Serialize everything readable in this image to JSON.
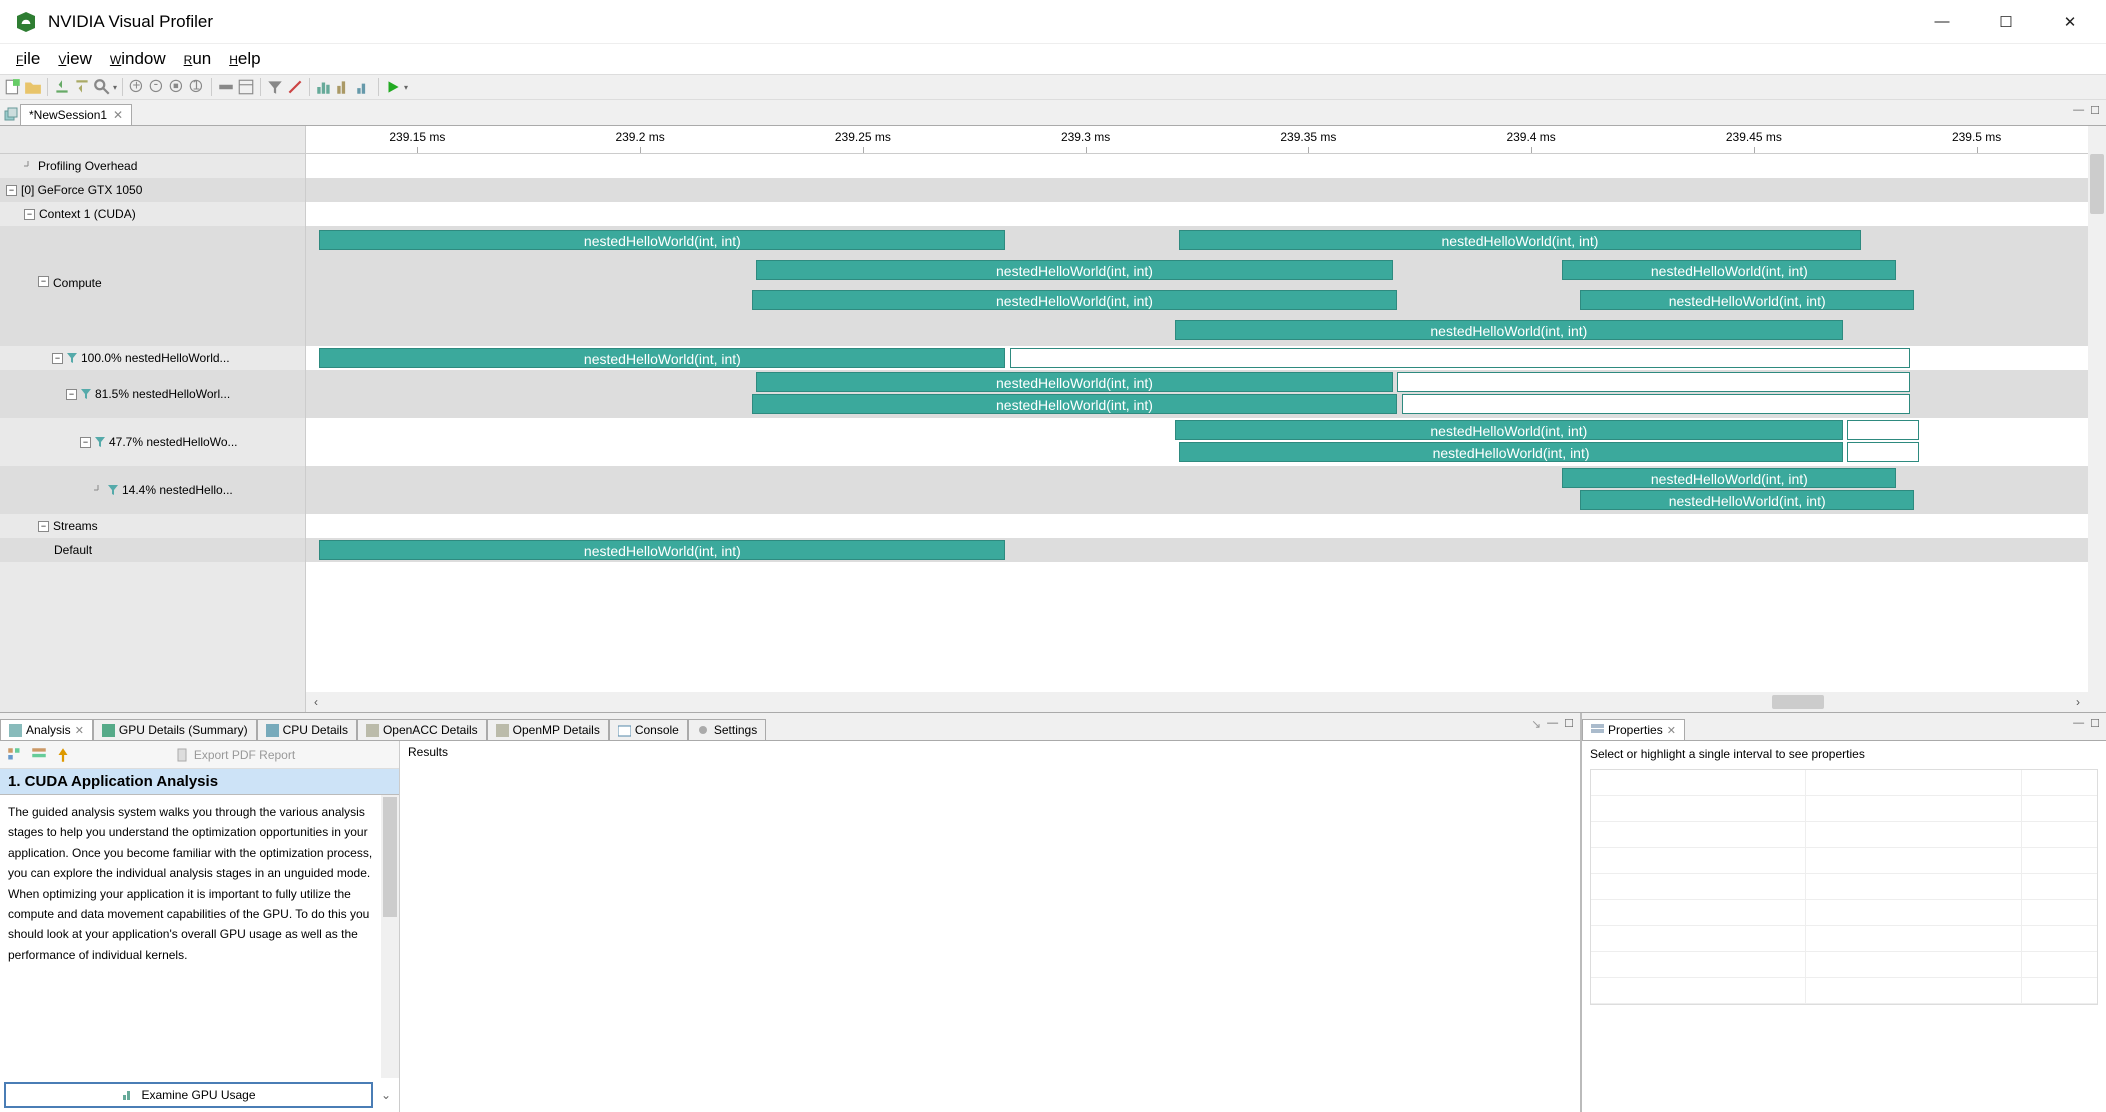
{
  "window": {
    "title": "NVIDIA Visual Profiler"
  },
  "menu": {
    "file": "File",
    "view": "View",
    "window": "Window",
    "run": "Run",
    "help": "Help"
  },
  "session_tab": {
    "label": "*NewSession1"
  },
  "ruler": {
    "ticks": [
      "239.15 ms",
      "239.2 ms",
      "239.25 ms",
      "239.3 ms",
      "239.35 ms",
      "239.4 ms",
      "239.45 ms",
      "239.5 ms"
    ]
  },
  "tree": {
    "overhead": "Profiling Overhead",
    "device": "[0] GeForce GTX 1050",
    "context": "Context 1 (CUDA)",
    "compute": "Compute",
    "k100": "100.0% nestedHelloWorld...",
    "k81": "81.5% nestedHelloWorl...",
    "k47": "47.7% nestedHelloWo...",
    "k14": "14.4% nestedHello...",
    "streams": "Streams",
    "default": "Default"
  },
  "kernel_label": "nestedHelloWorld(int, int)",
  "bottom_tabs": {
    "analysis": "Analysis",
    "gpu_details": "GPU Details (Summary)",
    "cpu_details": "CPU Details",
    "openacc": "OpenACC Details",
    "openmp": "OpenMP Details",
    "console": "Console",
    "settings": "Settings",
    "properties": "Properties"
  },
  "analysis": {
    "export": "Export PDF Report",
    "stage_title": "1. CUDA Application Analysis",
    "body": "The guided analysis system walks you through the various analysis stages to help you understand the optimization opportunities in your application. Once you become familiar with the optimization process, you can explore the individual analysis stages in an unguided mode. When optimizing your application it is important to fully utilize the compute and data movement capabilities of the GPU. To do this you should look at your application's overall GPU usage as well as the performance of individual kernels.",
    "action": "Examine GPU Usage",
    "results_header": "Results"
  },
  "properties": {
    "placeholder": "Select or highlight a single interval to see properties"
  },
  "chart_data": {
    "type": "gantt",
    "time_axis_ms": {
      "start": 239.125,
      "end": 239.525
    },
    "lanes": [
      {
        "name": "Profiling Overhead",
        "bars": []
      },
      {
        "name": "[0] GeForce GTX 1050",
        "bars": []
      },
      {
        "name": "Context 1 (CUDA)",
        "bars": []
      },
      {
        "name": "Compute",
        "bars": [
          {
            "label": "nestedHelloWorld(int, int)",
            "start": 239.128,
            "end": 239.282,
            "row": 0
          },
          {
            "label": "nestedHelloWorld(int, int)",
            "start": 239.321,
            "end": 239.474,
            "row": 0
          },
          {
            "label": "nestedHelloWorld(int, int)",
            "start": 239.226,
            "end": 239.369,
            "row": 1
          },
          {
            "label": "nestedHelloWorld(int, int)",
            "start": 239.407,
            "end": 239.482,
            "row": 1
          },
          {
            "label": "nestedHelloWorld(int, int)",
            "start": 239.225,
            "end": 239.37,
            "row": 2
          },
          {
            "label": "nestedHelloWorld(int, int)",
            "start": 239.411,
            "end": 239.486,
            "row": 2
          },
          {
            "label": "nestedHelloWorld(int, int)",
            "start": 239.32,
            "end": 239.47,
            "row": 3
          }
        ]
      },
      {
        "name": "100.0% nestedHelloWorld",
        "bars": [
          {
            "label": "nestedHelloWorld(int, int)",
            "start": 239.128,
            "end": 239.282,
            "row": 0
          },
          {
            "label": "",
            "start": 239.283,
            "end": 239.485,
            "row": 0,
            "outline": true
          }
        ]
      },
      {
        "name": "81.5% nestedHelloWorld",
        "bars": [
          {
            "label": "nestedHelloWorld(int, int)",
            "start": 239.226,
            "end": 239.369,
            "row": 0
          },
          {
            "label": "",
            "start": 239.37,
            "end": 239.485,
            "row": 0,
            "outline": true
          },
          {
            "label": "nestedHelloWorld(int, int)",
            "start": 239.225,
            "end": 239.37,
            "row": 1
          },
          {
            "label": "",
            "start": 239.371,
            "end": 239.485,
            "row": 1,
            "outline": true
          }
        ]
      },
      {
        "name": "47.7% nestedHelloWorld",
        "bars": [
          {
            "label": "nestedHelloWorld(int, int)",
            "start": 239.32,
            "end": 239.47,
            "row": 0
          },
          {
            "label": "",
            "start": 239.471,
            "end": 239.487,
            "row": 0,
            "outline": true
          },
          {
            "label": "nestedHelloWorld(int, int)",
            "start": 239.321,
            "end": 239.47,
            "row": 1
          },
          {
            "label": "",
            "start": 239.471,
            "end": 239.487,
            "row": 1,
            "outline": true
          }
        ]
      },
      {
        "name": "14.4% nestedHelloWorld",
        "bars": [
          {
            "label": "nestedHelloWorld(int, int)",
            "start": 239.407,
            "end": 239.482,
            "row": 0
          },
          {
            "label": "nestedHelloWorld(int, int)",
            "start": 239.411,
            "end": 239.486,
            "row": 1
          }
        ]
      },
      {
        "name": "Streams",
        "bars": []
      },
      {
        "name": "Default",
        "bars": [
          {
            "label": "nestedHelloWorld(int, int)",
            "start": 239.128,
            "end": 239.282,
            "row": 0
          }
        ]
      }
    ]
  }
}
